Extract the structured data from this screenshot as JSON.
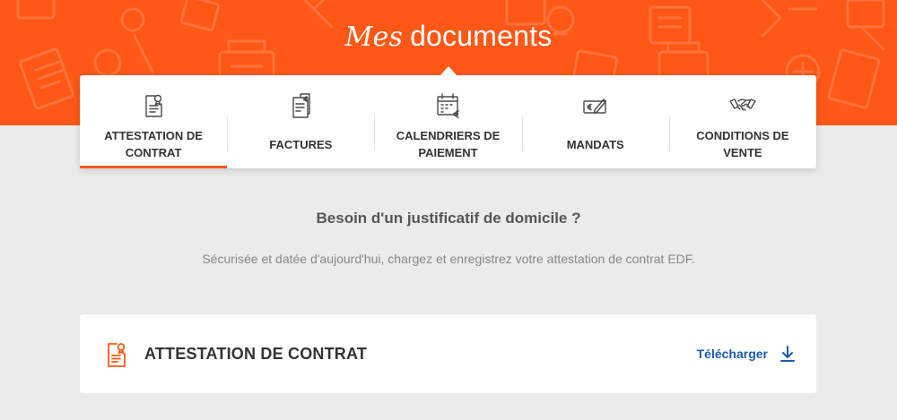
{
  "header": {
    "title_script": "Mes",
    "title_main": "documents"
  },
  "tabs": [
    {
      "label": "ATTESTATION DE\nCONTRAT",
      "icon": "certificate-icon",
      "active": true
    },
    {
      "label": "FACTURES",
      "icon": "invoice-icon",
      "active": false
    },
    {
      "label": "CALENDRIERS DE\nPAIEMENT",
      "icon": "calendar-euro-icon",
      "active": false
    },
    {
      "label": "MANDATS",
      "icon": "check-mandate-icon",
      "active": false
    },
    {
      "label": "CONDITIONS DE\nVENTE",
      "icon": "handshake-icon",
      "active": false
    }
  ],
  "main": {
    "subtitle": "Besoin d'un justificatif de domicile ?",
    "description": "Sécurisée et datée d'aujourd'hui, chargez et enregistrez votre attestation de contrat EDF."
  },
  "document": {
    "title": "ATTESTATION DE CONTRAT",
    "icon": "certificate-icon",
    "download_label": "Télécharger",
    "download_icon": "download-arrow-icon"
  },
  "colors": {
    "brand_orange": "#fe5716",
    "link_blue": "#1b5bb3",
    "background": "#ebebeb"
  }
}
